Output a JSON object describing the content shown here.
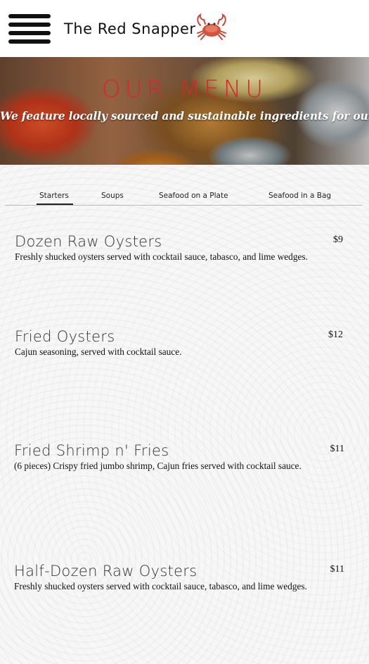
{
  "header": {
    "brand": "The Red Snapper",
    "menu_icon": "hamburger-icon",
    "logo_icon": "crab-icon",
    "brand_color": "#d9262c"
  },
  "hero": {
    "title": "OUR MENU",
    "subtitle": "We feature locally sourced and sustainable ingredients for our dishes."
  },
  "tabs": [
    {
      "label": "Starters",
      "active": true
    },
    {
      "label": "Soups",
      "active": false
    },
    {
      "label": "Seafood on a Plate",
      "active": false
    },
    {
      "label": "Seafood in a Bag",
      "active": false
    }
  ],
  "items": [
    {
      "name": "Dozen Raw Oysters",
      "price": "$9",
      "description": "Freshly shucked oysters served with cocktail sauce, tabasco, and lime wedges."
    },
    {
      "name": "Fried Oysters",
      "price": "$12",
      "description": "Cajun seasoning, served with cocktail sauce."
    },
    {
      "name": "Fried Shrimp n' Fries",
      "price": "$11",
      "description": "(6 pieces) Crispy fried jumbo shrimp, Cajun fries served with cocktail sauce."
    },
    {
      "name": "Half-Dozen Raw Oysters",
      "price": "$11",
      "description": "Freshly shucked oysters served with cocktail sauce, tabasco, and lime wedges."
    }
  ]
}
